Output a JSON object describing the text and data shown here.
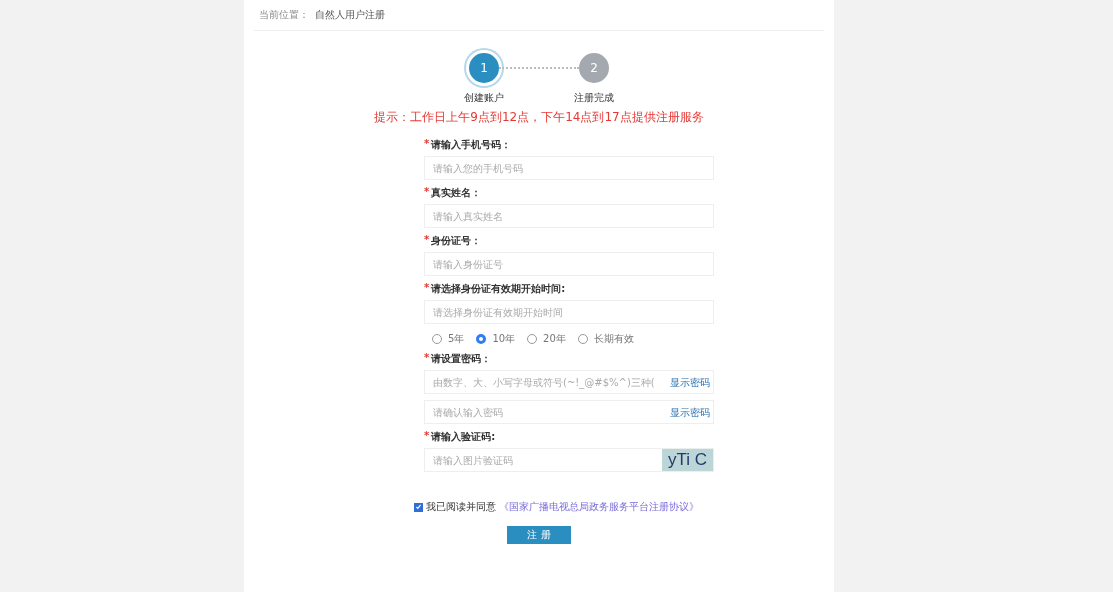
{
  "breadcrumb": {
    "label": "当前位置：",
    "current": "自然人用户注册"
  },
  "steps": [
    {
      "number": "1",
      "label": "创建账户",
      "active": true
    },
    {
      "number": "2",
      "label": "注册完成",
      "active": false
    }
  ],
  "notice": "提示：工作日上午9点到12点，下午14点到17点提供注册服务",
  "fields": [
    {
      "kind": "text",
      "label": "请输入手机号码：",
      "mark": "*",
      "placeholder": "请输入您的手机号码"
    },
    {
      "kind": "text",
      "label": "真实姓名：",
      "mark": "*",
      "placeholder": "请输入真实姓名"
    },
    {
      "kind": "text",
      "label": "身份证号：",
      "mark": "*",
      "placeholder": "请输入身份证号"
    },
    {
      "kind": "text",
      "label": "请选择身份证有效期开始时间:",
      "mark": "*",
      "placeholder": "请选择身份证有效期开始时间"
    },
    {
      "kind": "radio",
      "options": [
        {
          "label": "5年",
          "selected": false
        },
        {
          "label": "10年",
          "selected": true
        },
        {
          "label": "20年",
          "selected": false
        },
        {
          "label": "长期有效",
          "selected": false
        }
      ]
    },
    {
      "kind": "password",
      "label": "请设置密码：",
      "mark": "*",
      "placeholder": "由数字、大、小写字母或符号(~!_@#$%^)三种(",
      "action": "显示密码"
    },
    {
      "kind": "password",
      "placeholder": "请确认输入密码",
      "action": "显示密码"
    },
    {
      "kind": "captcha",
      "label": "请输入验证码:",
      "mark": "*",
      "placeholder": "请输入图片验证码",
      "captcha": "yTi C"
    }
  ],
  "agreement": {
    "checked": true,
    "text": "我已阅读并同意",
    "link": "《国家广播电视总局政务服务平台注册协议》"
  },
  "submit": "注 册"
}
